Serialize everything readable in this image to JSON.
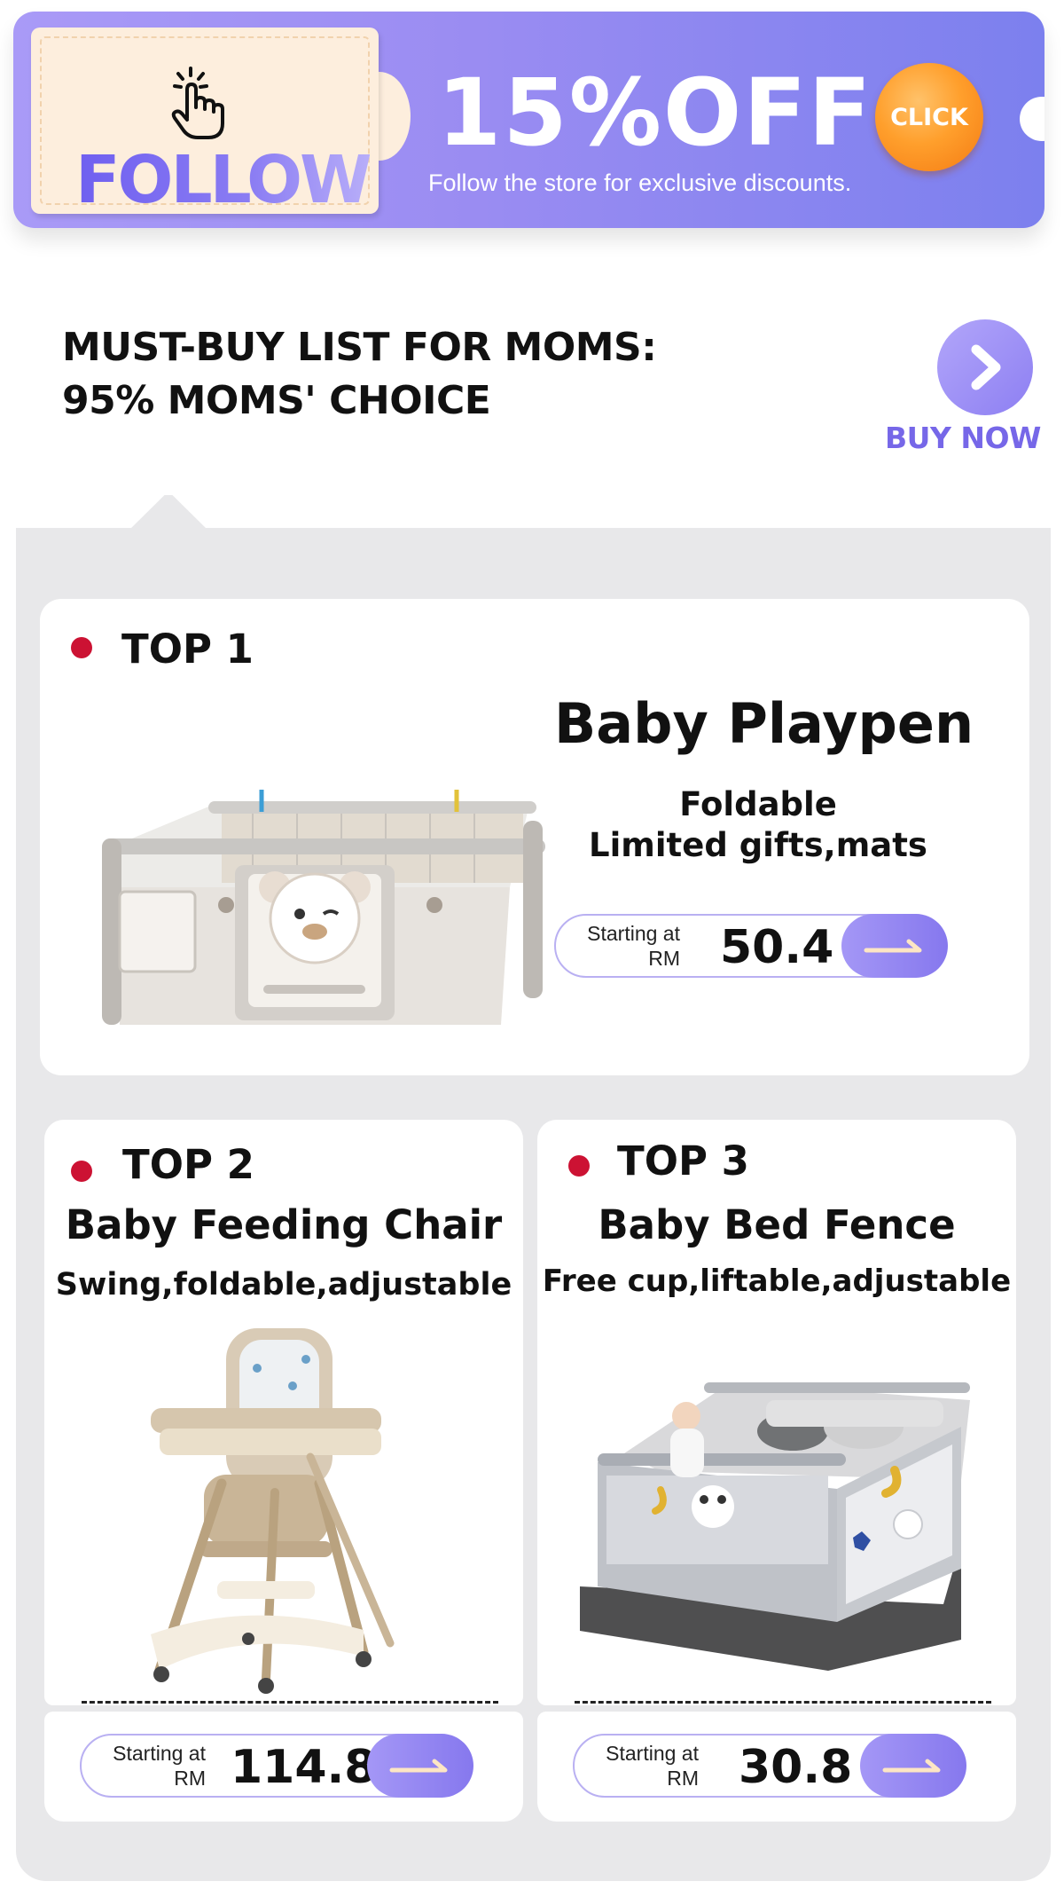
{
  "banner": {
    "follow_label": "FOLLOW",
    "discount_label": "15%OFF",
    "subtitle": "Follow the store for exclusive discounts.",
    "click_label": "CLICK"
  },
  "mustbuy": {
    "title_line1": "MUST-BUY LIST FOR MOMS:",
    "title_line2": "95% MOMS' CHOICE",
    "buy_now_label": "BUY NOW"
  },
  "products": [
    {
      "rank": "TOP 1",
      "name": "Baby Playpen",
      "features_line1": "Foldable",
      "features_line2": "Limited gifts,mats",
      "price_prefix_line1": "Starting at",
      "price_prefix_line2": "RM",
      "price": "50.4"
    },
    {
      "rank": "TOP 2",
      "name": "Baby Feeding Chair",
      "features_line1": "Swing,foldable,adjustable",
      "price_prefix_line1": "Starting at",
      "price_prefix_line2": "RM",
      "price": "114.8"
    },
    {
      "rank": "TOP 3",
      "name": "Baby Bed Fence",
      "features_line1": "Free cup,liftable,adjustable",
      "price_prefix_line1": "Starting at",
      "price_prefix_line2": "RM",
      "price": "30.8"
    }
  ],
  "colors": {
    "accent_purple": "#8d7ff2",
    "rank_dot_red": "#cc1233",
    "click_orange": "#ff9f2c",
    "panel_grey": "#e8e8ea"
  },
  "icons": {
    "follow": "pointing-hand-icon",
    "buy_now": "chevron-right-icon",
    "price_go": "arrow-right-icon"
  }
}
